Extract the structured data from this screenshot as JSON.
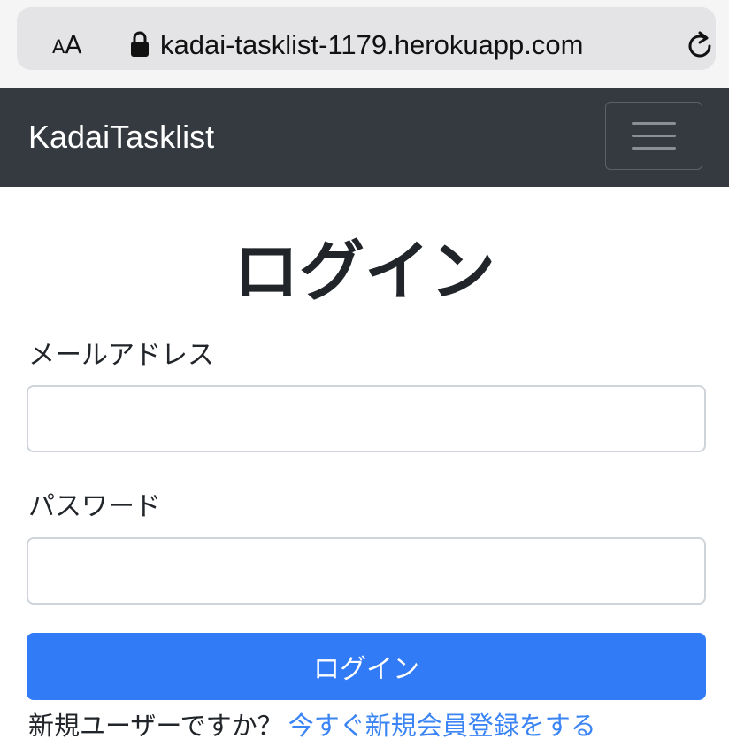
{
  "browser": {
    "text_size_small": "A",
    "text_size_big": "A",
    "url": "kadai-tasklist-1179.herokuapp.com"
  },
  "navbar": {
    "brand": "KadaiTasklist"
  },
  "login": {
    "title": "ログイン",
    "email_label": "メールアドレス",
    "email_value": "",
    "password_label": "パスワード",
    "password_value": "",
    "submit_label": "ログイン",
    "signup_prompt": "新規ユーザーですか？",
    "signup_link": "今すぐ新規会員登録をする"
  },
  "colors": {
    "navbar_bg": "#343a40",
    "primary_button": "#327bf6",
    "link": "#3a84f5"
  },
  "icons": [
    "lock-icon",
    "reload-icon",
    "hamburger-menu-icon"
  ]
}
